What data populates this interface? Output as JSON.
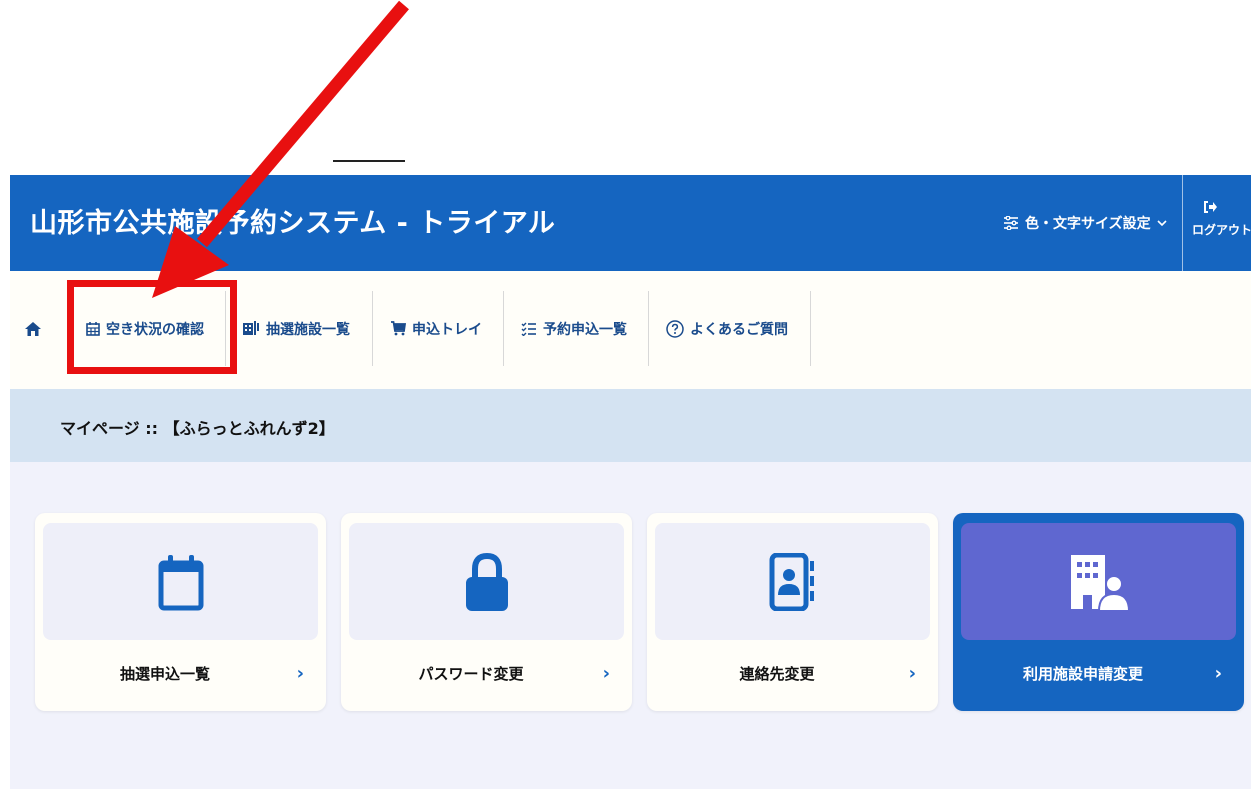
{
  "header": {
    "title": "山形市公共施設予約システム - トライアル",
    "settings_label": "色・文字サイズ設定",
    "logout_label": "ログアウト"
  },
  "nav": {
    "items": [
      {
        "label": "空き状況の確認",
        "icon": "calendar-icon"
      },
      {
        "label": "抽選施設一覧",
        "icon": "building-icon"
      },
      {
        "label": "申込トレイ",
        "icon": "cart-icon"
      },
      {
        "label": "予約申込一覧",
        "icon": "checklist-icon"
      },
      {
        "label": "よくあるご質問",
        "icon": "question-icon"
      }
    ]
  },
  "breadcrumb": {
    "title": "マイページ :: 【ふらっとふれんず2】"
  },
  "cards": [
    {
      "label": "抽選申込一覧",
      "icon": "calendar-icon"
    },
    {
      "label": "パスワード変更",
      "icon": "lock-icon"
    },
    {
      "label": "連絡先変更",
      "icon": "contact-book-icon"
    },
    {
      "label": "利用施設申請変更",
      "icon": "facility-person-icon"
    }
  ],
  "colors": {
    "primary": "#1565c0",
    "highlight": "#e81010",
    "active_icon_bg": "#5f67d0"
  }
}
